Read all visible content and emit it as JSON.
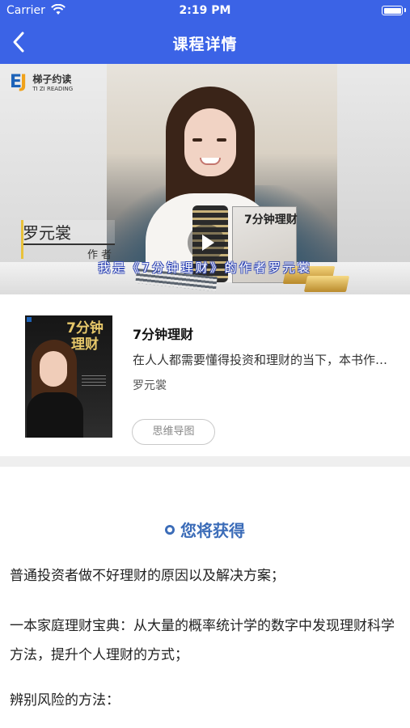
{
  "status_bar": {
    "carrier": "Carrier",
    "time": "2:19 PM"
  },
  "nav": {
    "title": "课程详情",
    "back_icon": "chevron-left-icon"
  },
  "video": {
    "logo_cn": "梯子约读",
    "logo_en": "TI ZI READING",
    "book_text": "7分钟理财",
    "name_tag": "罗元裳",
    "name_tag_sub": "作者",
    "subtitle": "我是《7分钟理财》的作者罗元裳",
    "play_icon": "play-icon"
  },
  "book": {
    "cover_title": "7分钟理财",
    "title": "7分钟理财",
    "description": "在人人都需要懂得投资和理财的当下，本书作者罗元裳从多年理财经验出发",
    "author": "罗元裳",
    "mindmap_label": "思维导图"
  },
  "gain": {
    "title": "您将获得",
    "items": [
      "普通投资者做不好理财的原因以及解决方案；",
      "一本家庭理财宝典：从大量的概率统计学的数字中发现理财科学方法，提升个人理财的方式；",
      "辨别风险的方法："
    ]
  },
  "colors": {
    "accent": "#3b63e6",
    "heading": "#3b6cb8"
  }
}
